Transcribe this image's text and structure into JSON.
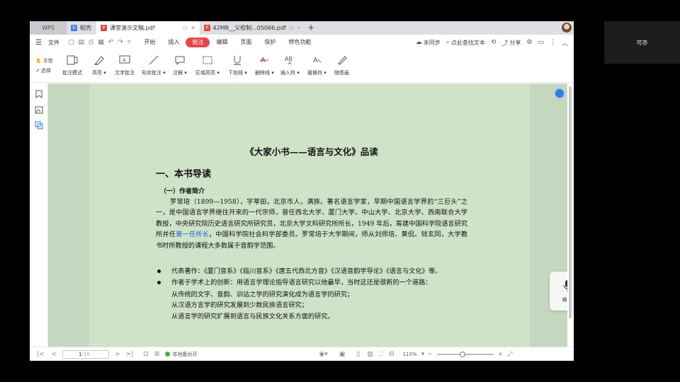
{
  "tabs": {
    "wps": "WPS",
    "dock": "稻壳",
    "active_file": "课堂演示文稿.pdf",
    "second_file": "42MB__父权制...05066.pdf"
  },
  "menu": {
    "file": "文件",
    "items": [
      "开始",
      "插入",
      "批注",
      "编辑",
      "页面",
      "保护",
      "特色功能"
    ],
    "active_index": 2,
    "sync": "未同步",
    "search": "点此查找文本",
    "share": "分享"
  },
  "toolbar": {
    "hand": "手型",
    "select": "选择",
    "tools": [
      "批注模式",
      "高亮",
      "文字批注",
      "形状批注",
      "注解",
      "区域高亮",
      "下划线",
      "删除线",
      "插入符",
      "替换符",
      "随意画"
    ]
  },
  "document": {
    "title": "《大家小书——语言与文化》品读",
    "heading1": "一、本书导读",
    "heading2": "（一）作者简介",
    "para_before_link": "罗常培（1899—1958），字莘田，北京市人，满族。著名语言学家，早期中国语言学界的“三巨头”之一，是中国语言学界继往开来的一代宗师，曾任西北大学、厦门大学、中山大学、北京大学、西南联合大学教授，中央研究院历史语言研究所研究员，北京大学文科研究所所长，1949 年后，筹建中国科学院语言研究所并任",
    "para_link": "第一任所长",
    "para_after_link": "，中国科学院社会科学部委员。罗常培于大学期间，师从刘师培、黄侃、钱玄同，大学教书时所教授的课程大多数属于音韵学范围。",
    "bullet1": "代表著作：《厦门音系》《临川音系》《唐五代西北方音》《汉语音韵学导论》《语言与文化》等。",
    "bullet2": "作者于学术上的创新：用语言学理论指导语言研究以他最早，当时这还是很新的一个道路：",
    "sub1": "从传统的文字、音韵、训诂之学的研究演化成为语言学的研究；",
    "sub2": "从汉语方言学的研究发展到少数民族语言研究；",
    "sub3": "从语言学的研究扩展到语言与民族文化关系方面的研究。"
  },
  "voice": {
    "label": "唤醒"
  },
  "status": {
    "page": "1",
    "total": "/16",
    "backup": "本地备份开",
    "zoom": "110%",
    "zoom_level": 0.45
  },
  "side_label": "可亦",
  "colors": {
    "accent": "#e9454a",
    "doc_bg": "#cfe3c8",
    "link": "#1f5cd6"
  }
}
